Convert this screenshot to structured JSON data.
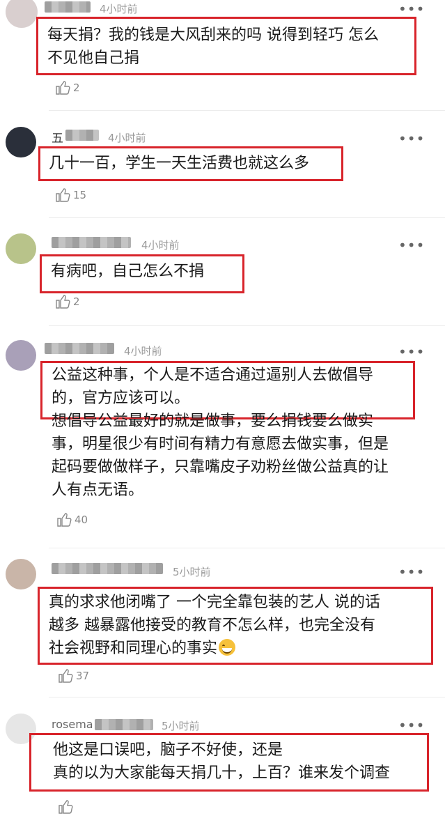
{
  "comments": [
    {
      "time": "4小时前",
      "text": "每天捐？我的钱是大风刮来的吗 说得到轻巧 怎么\n不见他自己捐",
      "extra": "",
      "likes": "2",
      "avatar_color": "#d9cfcf"
    },
    {
      "username": "五",
      "time": "4小时前",
      "text": "几十一百，学生一天生活费也就这么多",
      "extra": "",
      "likes": "15",
      "avatar_color": "#2a2f3a"
    },
    {
      "time": "4小时前",
      "text": "有病吧，自己怎么不捐",
      "extra": "",
      "likes": "2",
      "avatar_color": "#b8c38a"
    },
    {
      "time": "4小时前",
      "text": "公益这种事，个人是不适合通过逼别人去做倡导\n的，官方应该可以。",
      "extra": "想倡导公益最好的就是做事，要么捐钱要么做实\n事，明星很少有时间有精力有意愿去做实事，但是\n起码要做做样子，只靠嘴皮子劝粉丝做公益真的让\n人有点无语。",
      "likes": "40",
      "avatar_color": "#a9a0b8"
    },
    {
      "time": "5小时前",
      "text": "真的求求他闭嘴了 一个完全靠包装的艺人 说的话\n越多 越暴露他接受的教育不怎么样，也完全没有\n社会视野和同理心的事实",
      "extra": "",
      "likes": "37",
      "avatar_color": "#c9b5a8"
    },
    {
      "username": "rosema",
      "time": "5小时前",
      "text": "他这是口误吧，脑子不好使，还是\n真的以为大家能每天捐几十，上百？谁来发个调查",
      "extra": "",
      "likes": "",
      "avatar_color": "#e6e6e6"
    }
  ],
  "icons": {
    "more": "more-dots-icon",
    "like": "thumbs-up-icon",
    "emoji": "grinning-sweat-emoji"
  },
  "colors": {
    "highlight_box": "#d8242b",
    "meta_gray": "#9a9a9a"
  }
}
